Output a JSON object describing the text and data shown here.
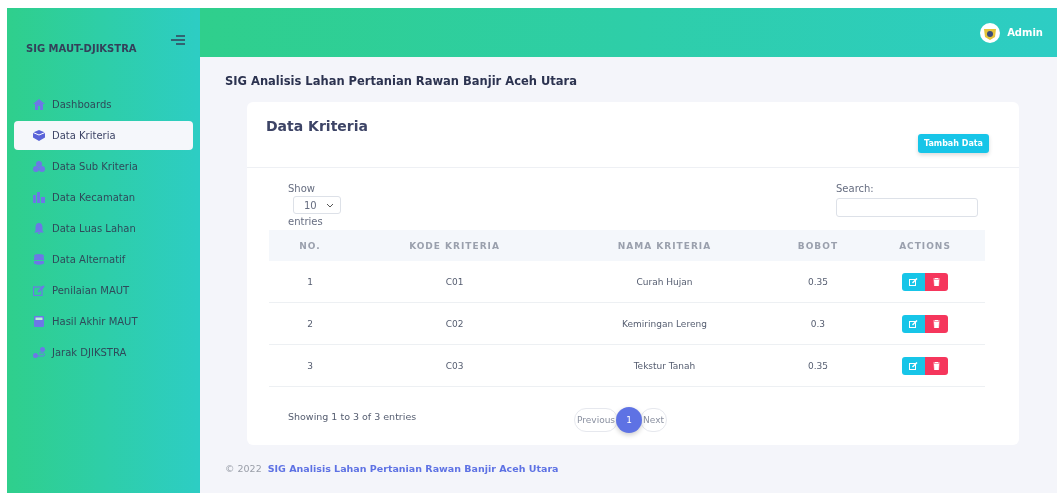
{
  "sidebar": {
    "brand": "SIG MAUT-DJIKSTRA",
    "items": [
      {
        "label": "Dashboards",
        "selected": false
      },
      {
        "label": "Data Kriteria",
        "selected": true
      },
      {
        "label": "Data Sub Kriteria",
        "selected": false
      },
      {
        "label": "Data Kecamatan",
        "selected": false
      },
      {
        "label": "Data Luas Lahan",
        "selected": false
      },
      {
        "label": "Data Alternatif",
        "selected": false
      },
      {
        "label": "Penilaian MAUT",
        "selected": false
      },
      {
        "label": "Hasil Akhir MAUT",
        "selected": false
      },
      {
        "label": "Jarak DJIKSTRA",
        "selected": false
      }
    ]
  },
  "topbar": {
    "user": "Admin"
  },
  "page_title": "SIG Analisis Lahan Pertanian Rawan Banjir Aceh Utara",
  "card": {
    "title": "Data Kriteria",
    "add_button": "Tambah Data",
    "length": {
      "show": "Show",
      "value": "10",
      "entries": "entries"
    },
    "search": {
      "label": "Search:"
    },
    "table": {
      "columns": [
        "NO.",
        "KODE KRITERIA",
        "NAMA KRITERIA",
        "BOBOT",
        "ACTIONS"
      ],
      "rows": [
        [
          "1",
          "C01",
          "Curah Hujan",
          "0.35"
        ],
        [
          "2",
          "C02",
          "Kemiringan Lereng",
          "0.3"
        ],
        [
          "3",
          "C03",
          "Tekstur Tanah",
          "0.35"
        ]
      ]
    },
    "info": "Showing 1 to 3 of 3 entries",
    "pagination": {
      "previous": "Previous",
      "pages": [
        {
          "label": "1",
          "selected": true
        }
      ],
      "next": "Next"
    }
  },
  "footer": {
    "year": "© 2022",
    "link": "SIG Analisis Lahan Pertanian Rawan Banjir Aceh Utara"
  }
}
